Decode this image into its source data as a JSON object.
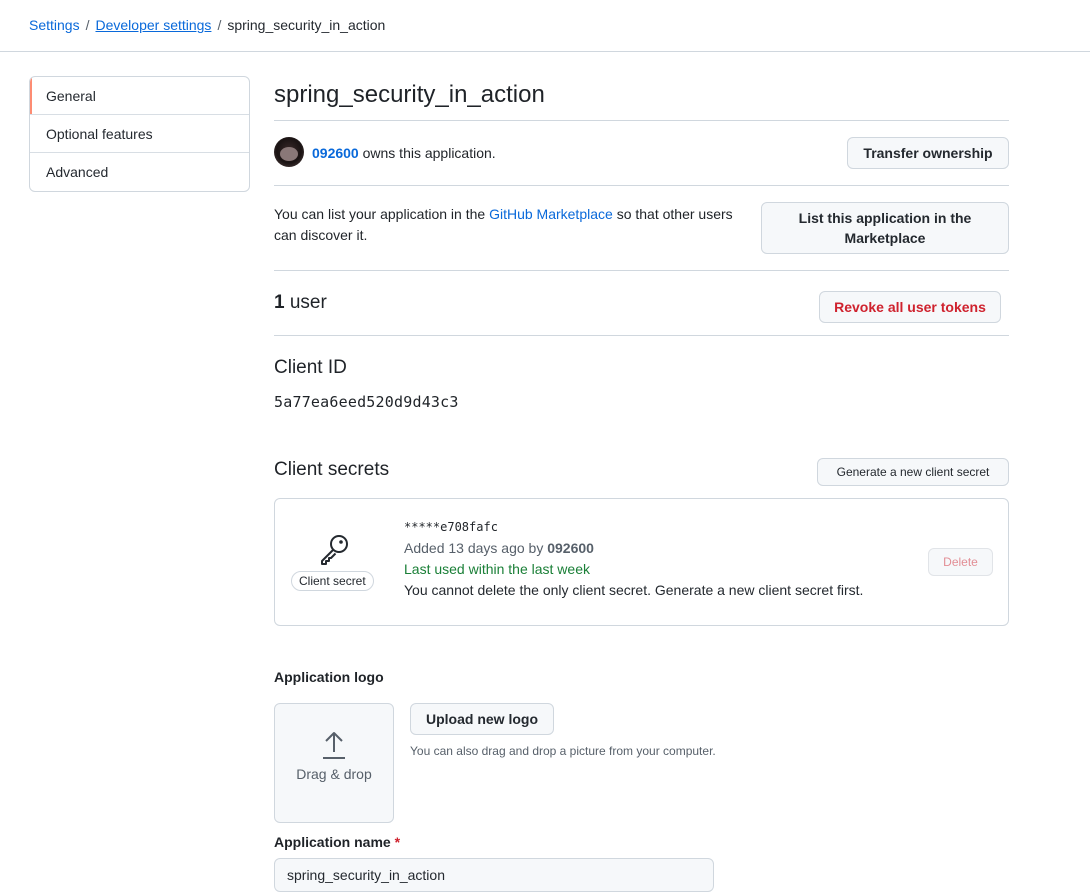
{
  "breadcrumb": {
    "items": [
      "Settings",
      "Developer settings"
    ],
    "separator": "/",
    "current": "spring_security_in_action"
  },
  "sidebar": {
    "items": [
      {
        "label": "General",
        "active": true
      },
      {
        "label": "Optional features"
      },
      {
        "label": "Advanced"
      }
    ]
  },
  "app": {
    "title": "spring_security_in_action",
    "owner_name": "092600",
    "owner_suffix": "owns this application.",
    "transfer_button": "Transfer ownership"
  },
  "marketplace": {
    "text_before": "You can list your application in the",
    "link": "GitHub Marketplace",
    "text_after": "so that other users can discover it.",
    "button": "List this application in the Marketplace"
  },
  "users": {
    "count": "1",
    "label": "user",
    "revoke_button": "Revoke all user tokens"
  },
  "client_id": {
    "heading": "Client ID",
    "value": "5a77ea6eed520d9d43c3"
  },
  "client_secrets": {
    "heading": "Client secrets",
    "generate_button": "Generate a new client secret",
    "secret": {
      "label": "Client secret",
      "masked": "*****e708fafc",
      "added_prefix": "Added 13 days ago by",
      "added_by": "092600",
      "last_used": "Last used within the last week",
      "note": "You cannot delete the only client secret. Generate a new client secret first.",
      "delete_button": "Delete"
    }
  },
  "logo": {
    "heading": "Application logo",
    "dropzone_label": "Drag & drop",
    "upload_button": "Upload new logo",
    "hint": "You can also drag and drop a picture from your computer."
  },
  "app_name": {
    "label": "Application name",
    "required_mark": "*",
    "value": "spring_security_in_action"
  },
  "colors": {
    "link": "#0969da",
    "danger": "#cf222e",
    "success": "#1a7f37",
    "active_marker": "#fd8c73"
  }
}
